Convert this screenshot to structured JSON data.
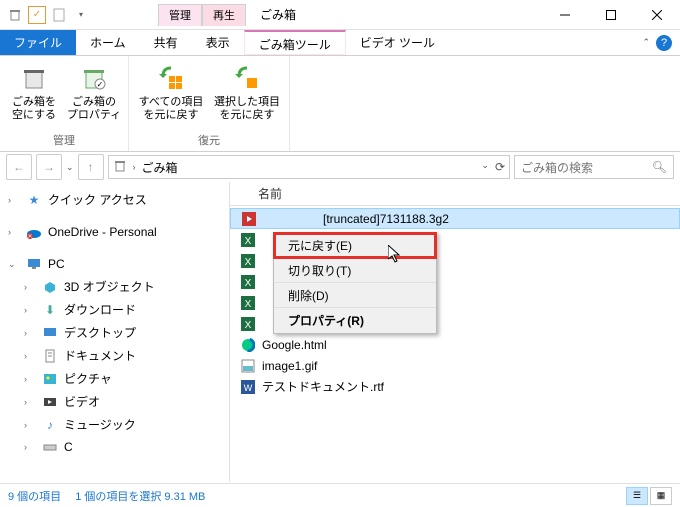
{
  "title": "ごみ箱",
  "tool_tabs": {
    "manage": "管理",
    "play": "再生",
    "recycle_tool": "ごみ箱ツール",
    "video_tool": "ビデオ ツール"
  },
  "tabs": {
    "file": "ファイル",
    "home": "ホーム",
    "share": "共有",
    "view": "表示"
  },
  "ribbon": {
    "empty": "ごみ箱を\n空にする",
    "props": "ごみ箱の\nプロパティ",
    "manage_label": "管理",
    "restore_all": "すべての項目\nを元に戻す",
    "restore_sel": "選択した項目\nを元に戻す",
    "restore_label": "復元"
  },
  "breadcrumb": {
    "loc": "ごみ箱"
  },
  "search": {
    "placeholder": "ごみ箱の検索"
  },
  "sidebar": {
    "quick": "クイック アクセス",
    "onedrive": "OneDrive - Personal",
    "pc": "PC",
    "items": [
      "3D オブジェクト",
      "ダウンロード",
      "デスクトップ",
      "ドキュメント",
      "ピクチャ",
      "ビデオ",
      "ミュージック",
      "C"
    ]
  },
  "column": {
    "name": "名前"
  },
  "files": [
    {
      "name": "[truncated]7131188.3g2",
      "icon": "video"
    },
    {
      "name": "",
      "icon": "excel"
    },
    {
      "name": "",
      "icon": "excel"
    },
    {
      "name": "",
      "icon": "excel"
    },
    {
      "name": "",
      "icon": "excel"
    },
    {
      "name": "",
      "icon": "excel"
    },
    {
      "name": "Google.html",
      "icon": "edge"
    },
    {
      "name": "image1.gif",
      "icon": "image"
    },
    {
      "name": "テストドキュメント.rtf",
      "icon": "word"
    }
  ],
  "context_menu": [
    "元に戻す(E)",
    "切り取り(T)",
    "削除(D)",
    "プロパティ(R)"
  ],
  "status": {
    "count": "9 個の項目",
    "selection": "1 個の項目を選択 9.31 MB"
  }
}
